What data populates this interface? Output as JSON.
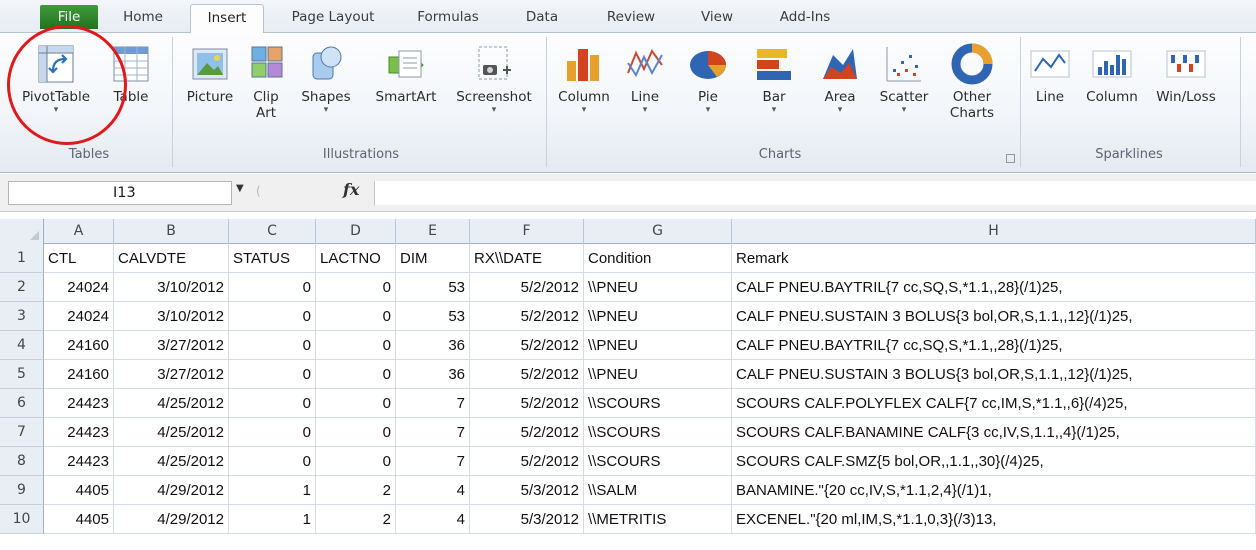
{
  "ribbon_tabs": [
    "File",
    "Home",
    "Insert",
    "Page Layout",
    "Formulas",
    "Data",
    "Review",
    "View",
    "Add-Ins"
  ],
  "ribbon": {
    "tables": {
      "label": "Tables",
      "pivottable": "PivotTable",
      "table": "Table"
    },
    "illustrations": {
      "label": "Illustrations",
      "picture": "Picture",
      "clip_art": "Clip Art",
      "shapes": "Shapes",
      "smartart": "SmartArt",
      "screenshot": "Screenshot"
    },
    "charts": {
      "label": "Charts",
      "column": "Column",
      "line": "Line",
      "pie": "Pie",
      "bar": "Bar",
      "area": "Area",
      "scatter": "Scatter",
      "other": "Other Charts"
    },
    "sparklines": {
      "label": "Sparklines",
      "line": "Line",
      "column": "Column",
      "winloss": "Win/Loss"
    }
  },
  "formula_bar": {
    "name_box": "I13",
    "fx": "fx",
    "formula": ""
  },
  "grid": {
    "columns": [
      "A",
      "B",
      "C",
      "D",
      "E",
      "F",
      "G",
      "H"
    ],
    "row_numbers": [
      "1",
      "2",
      "3",
      "4",
      "5",
      "6",
      "7",
      "8",
      "9",
      "10"
    ],
    "header": [
      "CTL",
      "CALVDTE",
      "STATUS",
      "LACTNO",
      "DIM",
      "RX\\\\DATE",
      "Condition",
      "Remark"
    ],
    "rows": [
      [
        "24024",
        "3/10/2012",
        "0",
        "0",
        "53",
        "5/2/2012",
        "\\\\PNEU",
        "CALF PNEU.BAYTRIL{7 cc,SQ,S,*1.1,,28}(/1)25,"
      ],
      [
        "24024",
        "3/10/2012",
        "0",
        "0",
        "53",
        "5/2/2012",
        "\\\\PNEU",
        "CALF PNEU.SUSTAIN 3 BOLUS{3 bol,OR,S,1.1,,12}(/1)25,"
      ],
      [
        "24160",
        "3/27/2012",
        "0",
        "0",
        "36",
        "5/2/2012",
        "\\\\PNEU",
        "CALF PNEU.BAYTRIL{7 cc,SQ,S,*1.1,,28}(/1)25,"
      ],
      [
        "24160",
        "3/27/2012",
        "0",
        "0",
        "36",
        "5/2/2012",
        "\\\\PNEU",
        "CALF PNEU.SUSTAIN 3 BOLUS{3 bol,OR,S,1.1,,12}(/1)25,"
      ],
      [
        "24423",
        "4/25/2012",
        "0",
        "0",
        "7",
        "5/2/2012",
        "\\\\SCOURS",
        "SCOURS CALF.POLYFLEX CALF{7 cc,IM,S,*1.1,,6}(/4)25,"
      ],
      [
        "24423",
        "4/25/2012",
        "0",
        "0",
        "7",
        "5/2/2012",
        "\\\\SCOURS",
        "SCOURS CALF.BANAMINE CALF{3 cc,IV,S,1.1,,4}(/1)25,"
      ],
      [
        "24423",
        "4/25/2012",
        "0",
        "0",
        "7",
        "5/2/2012",
        "\\\\SCOURS",
        "SCOURS CALF.SMZ{5 bol,OR,,1.1,,30}(/4)25,"
      ],
      [
        "4405",
        "4/29/2012",
        "1",
        "2",
        "4",
        "5/3/2012",
        "\\\\SALM",
        "BANAMINE.\"{20 cc,IV,S,*1.1,2,4}(/1)1,"
      ],
      [
        "4405",
        "4/29/2012",
        "1",
        "2",
        "4",
        "5/3/2012",
        "\\\\METRITIS",
        "EXCENEL.\"{20 ml,IM,S,*1.1,0,3}(/3)13,"
      ]
    ]
  },
  "colors": {
    "file_tab": "#2a7f24",
    "annotation_circle": "#e0191b",
    "header_fill": "#e9eef4"
  }
}
